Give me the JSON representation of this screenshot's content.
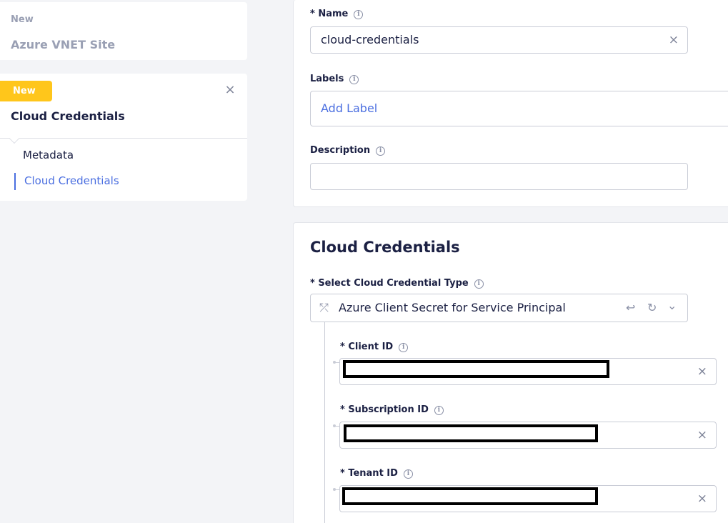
{
  "sidebar": {
    "parent": {
      "badge": "New",
      "title": "Azure VNET Site"
    },
    "current": {
      "badge": "New",
      "title": "Cloud Credentials",
      "close_icon": "×",
      "nav": [
        {
          "label": "Metadata",
          "active": false
        },
        {
          "label": "Cloud Credentials",
          "active": true
        }
      ]
    }
  },
  "form": {
    "name": {
      "label": "* Name",
      "value": "cloud-credentials",
      "clear_icon": "×"
    },
    "labels": {
      "label": "Labels",
      "placeholder": "Add Label"
    },
    "description": {
      "label": "Description",
      "value": ""
    },
    "info_icon": "i"
  },
  "credentials": {
    "title": "Cloud Credentials",
    "type_label": "* Select Cloud Credential Type",
    "type_value": "Azure Client Secret for Service Principal",
    "type_icon": "⤱",
    "actions": {
      "undo": "↩",
      "reset": "↻",
      "expand": "⌄"
    },
    "fields": [
      {
        "label": "* Client ID",
        "clear_icon": "×"
      },
      {
        "label": "* Subscription ID",
        "clear_icon": "×"
      },
      {
        "label": "* Tenant ID",
        "clear_icon": "×"
      }
    ]
  },
  "colors": {
    "accent": "#4a6ee0",
    "badge": "#ffc61b",
    "text": "#1b2043",
    "muted": "#9aa0b4"
  }
}
